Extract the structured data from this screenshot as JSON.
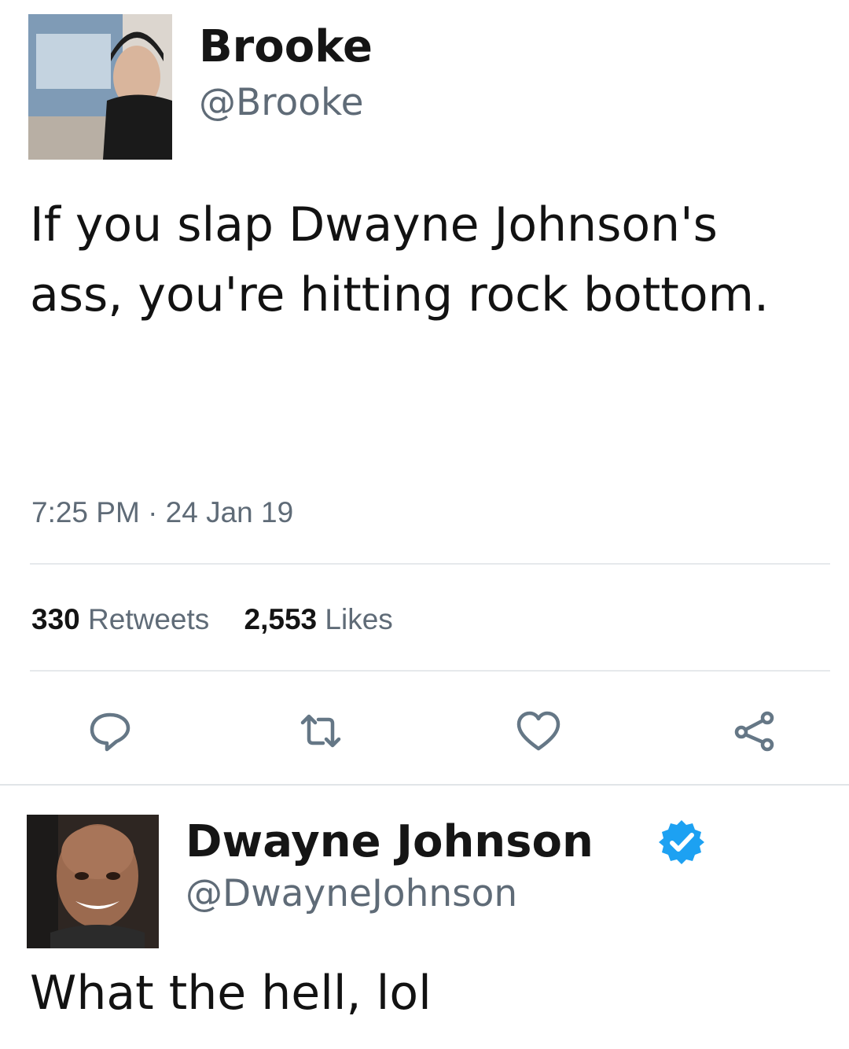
{
  "tweet": {
    "author_name": "Brooke",
    "author_handle": "@Brooke",
    "text": "If you slap Dwayne Johnson's ass, you're hitting rock bottom.",
    "timestamp": "7:25 PM · 24 Jan 19",
    "retweets_count": "330",
    "retweets_label": "Retweets",
    "likes_count": "2,553",
    "likes_label": "Likes"
  },
  "actions": {
    "reply_icon": "reply-icon",
    "retweet_icon": "retweet-icon",
    "like_icon": "heart-icon",
    "share_icon": "share-icon"
  },
  "reply": {
    "author_name": "Dwayne Johnson",
    "author_handle": "@DwayneJohnson",
    "verified_icon": "verified-badge-icon",
    "text": "What the hell, lol"
  },
  "colors": {
    "text": "#141414",
    "muted": "#5f6b77",
    "icon": "#657786",
    "verified": "#1da1f2",
    "divider": "#e6e9ec"
  }
}
